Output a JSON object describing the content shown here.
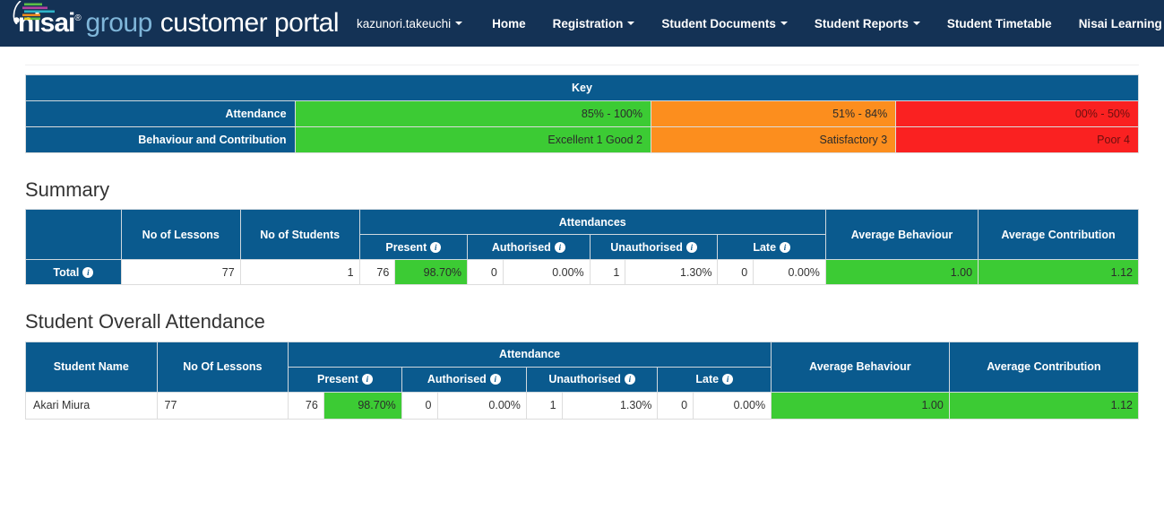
{
  "brand": {
    "nisai": "nisai",
    "registered": "®",
    "group": "group",
    "portal": "customer portal",
    "logo_icon": "nisai-logo-icon",
    "logo_bar_colors": [
      "#5bbf47",
      "#b341a0",
      "#2fb5c9",
      "#f08a1e",
      "#e8d020"
    ]
  },
  "nav": {
    "user": "kazunori.takeuchi",
    "items": [
      {
        "label": "Home",
        "caret": false
      },
      {
        "label": "Registration",
        "caret": true
      },
      {
        "label": "Student Documents",
        "caret": true
      },
      {
        "label": "Student Reports",
        "caret": true
      },
      {
        "label": "Student Timetable",
        "caret": false
      },
      {
        "label": "Nisai Learning Credits",
        "caret": true
      }
    ]
  },
  "colors": {
    "navbar": "#143255",
    "header_blue": "#0a5a8e",
    "green": "#3ccb34",
    "orange": "#fc8e1e",
    "red": "#fa2121"
  },
  "key": {
    "title": "Key",
    "rows": [
      {
        "label": "Attendance",
        "bands": [
          {
            "text": "85% - 100%",
            "color": "green"
          },
          {
            "text": "51% - 84%",
            "color": "orange"
          },
          {
            "text": "00% - 50%",
            "color": "red"
          }
        ]
      },
      {
        "label": "Behaviour and Contribution",
        "bands": [
          {
            "text": "Excellent 1 Good 2",
            "color": "green"
          },
          {
            "text": "Satisfactory 3",
            "color": "orange"
          },
          {
            "text": "Poor 4",
            "color": "red"
          }
        ]
      }
    ]
  },
  "summary": {
    "heading": "Summary",
    "headers": {
      "blank": "",
      "no_of_lessons": "No of Lessons",
      "no_of_students": "No of Students",
      "attendances": "Attendances",
      "present": "Present",
      "authorised": "Authorised",
      "unauthorised": "Unauthorised",
      "late": "Late",
      "average_behaviour": "Average Behaviour",
      "average_contribution": "Average Contribution"
    },
    "row": {
      "label": "Total",
      "no_of_lessons": "77",
      "no_of_students": "1",
      "present_count": "76",
      "present_pct": "98.70%",
      "authorised_count": "0",
      "authorised_pct": "0.00%",
      "unauthorised_count": "1",
      "unauthorised_pct": "1.30%",
      "late_count": "0",
      "late_pct": "0.00%",
      "average_behaviour": "1.00",
      "average_contribution": "1.12"
    }
  },
  "student_overall": {
    "heading": "Student Overall Attendance",
    "headers": {
      "student_name": "Student Name",
      "no_of_lessons": "No Of Lessons",
      "attendance": "Attendance",
      "present": "Present",
      "authorised": "Authorised",
      "unauthorised": "Unauthorised",
      "late": "Late",
      "average_behaviour": "Average Behaviour",
      "average_contribution": "Average Contribution"
    },
    "rows": [
      {
        "student_name": "Akari Miura",
        "no_of_lessons": "77",
        "present_count": "76",
        "present_pct": "98.70%",
        "authorised_count": "0",
        "authorised_pct": "0.00%",
        "unauthorised_count": "1",
        "unauthorised_pct": "1.30%",
        "late_count": "0",
        "late_pct": "0.00%",
        "average_behaviour": "1.00",
        "average_contribution": "1.12"
      }
    ]
  }
}
